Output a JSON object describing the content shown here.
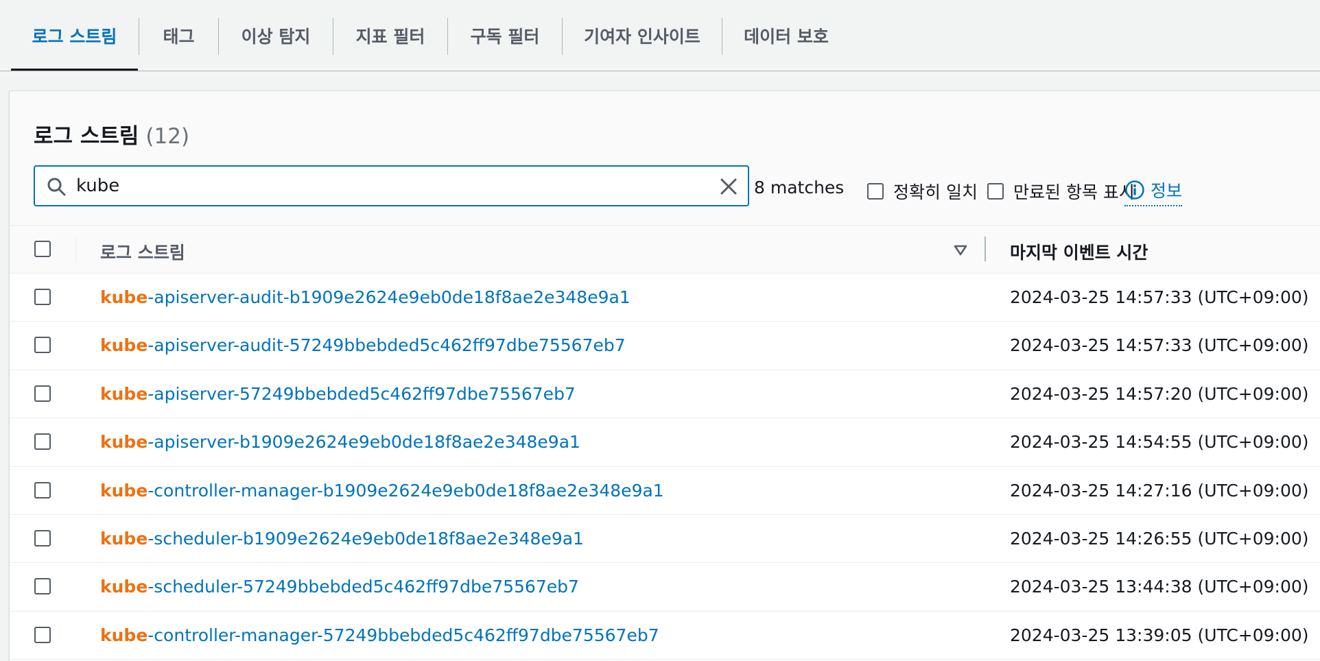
{
  "tabs": [
    {
      "label": "로그 스트림",
      "active": true
    },
    {
      "label": "태그"
    },
    {
      "label": "이상 탐지"
    },
    {
      "label": "지표 필터"
    },
    {
      "label": "구독 필터"
    },
    {
      "label": "기여자 인사이트"
    },
    {
      "label": "데이터 보호"
    }
  ],
  "panel": {
    "title": "로그 스트림",
    "count": "(12)"
  },
  "search": {
    "value": "kube",
    "matches_text": "8 matches"
  },
  "options": {
    "exact_match_label": "정확히 일치",
    "show_expired_label": "만료된 항목 표시",
    "info_label": "정보"
  },
  "table": {
    "columns": {
      "name": "로그 스트림",
      "last_event": "마지막 이벤트 시간"
    },
    "rows": [
      {
        "highlight": "kube",
        "rest": "-apiserver-audit-b1909e2624e9eb0de18f8ae2e348e9a1",
        "time": "2024-03-25 14:57:33 (UTC+09:00)"
      },
      {
        "highlight": "kube",
        "rest": "-apiserver-audit-57249bbebded5c462ff97dbe75567eb7",
        "time": "2024-03-25 14:57:33 (UTC+09:00)"
      },
      {
        "highlight": "kube",
        "rest": "-apiserver-57249bbebded5c462ff97dbe75567eb7",
        "time": "2024-03-25 14:57:20 (UTC+09:00)"
      },
      {
        "highlight": "kube",
        "rest": "-apiserver-b1909e2624e9eb0de18f8ae2e348e9a1",
        "time": "2024-03-25 14:54:55 (UTC+09:00)"
      },
      {
        "highlight": "kube",
        "rest": "-controller-manager-b1909e2624e9eb0de18f8ae2e348e9a1",
        "time": "2024-03-25 14:27:16 (UTC+09:00)"
      },
      {
        "highlight": "kube",
        "rest": "-scheduler-b1909e2624e9eb0de18f8ae2e348e9a1",
        "time": "2024-03-25 14:26:55 (UTC+09:00)"
      },
      {
        "highlight": "kube",
        "rest": "-scheduler-57249bbebded5c462ff97dbe75567eb7",
        "time": "2024-03-25 13:44:38 (UTC+09:00)"
      },
      {
        "highlight": "kube",
        "rest": "-controller-manager-57249bbebded5c462ff97dbe75567eb7",
        "time": "2024-03-25 13:39:05 (UTC+09:00)"
      }
    ]
  },
  "colors": {
    "link": "#0073bb",
    "highlight": "#ec7211",
    "active_tab": "#0073bb"
  },
  "icons": {
    "search": "search-icon",
    "clear": "close-icon",
    "info": "info-icon",
    "sort": "sort-descending-icon"
  }
}
